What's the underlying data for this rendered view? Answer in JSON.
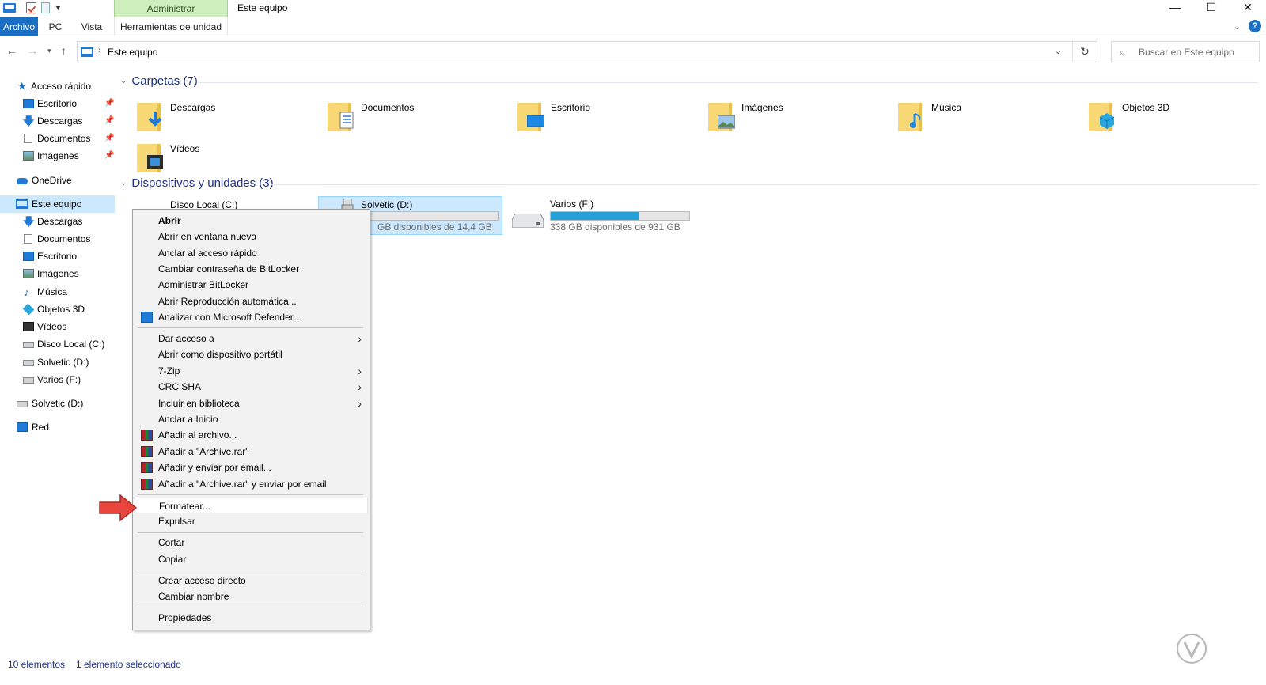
{
  "window": {
    "title": "Este equipo",
    "context_tab_header": "Administrar",
    "controls": [
      "—",
      "☐",
      "✕"
    ]
  },
  "ribbon": {
    "tabs": [
      "Archivo",
      "PC",
      "Vista",
      "Herramientas de unidad"
    ]
  },
  "address": {
    "path": "Este equipo",
    "search_placeholder": "Buscar en Este equipo"
  },
  "nav": {
    "items": [
      {
        "label": "Acceso rápido",
        "icon": "star-icon"
      },
      {
        "label": "Escritorio",
        "icon": "desktop-icon",
        "pinned": true
      },
      {
        "label": "Descargas",
        "icon": "download-icon",
        "pinned": true
      },
      {
        "label": "Documentos",
        "icon": "document-icon",
        "pinned": true
      },
      {
        "label": "Imágenes",
        "icon": "image-icon",
        "pinned": true
      },
      {
        "label": "OneDrive",
        "icon": "cloud-icon"
      },
      {
        "label": "Este equipo",
        "icon": "pc-icon",
        "selected": true
      },
      {
        "label": "Descargas",
        "icon": "download-icon"
      },
      {
        "label": "Documentos",
        "icon": "document-icon"
      },
      {
        "label": "Escritorio",
        "icon": "desktop-icon"
      },
      {
        "label": "Imágenes",
        "icon": "image-icon"
      },
      {
        "label": "Música",
        "icon": "music-icon"
      },
      {
        "label": "Objetos 3D",
        "icon": "cube-icon"
      },
      {
        "label": "Vídeos",
        "icon": "video-icon"
      },
      {
        "label": "Disco Local (C:)",
        "icon": "drive-icon"
      },
      {
        "label": "Solvetic (D:)",
        "icon": "usb-drive-icon"
      },
      {
        "label": "Varios (F:)",
        "icon": "drive-icon"
      },
      {
        "label": "Solvetic (D:)",
        "icon": "usb-drive-icon"
      },
      {
        "label": "Red",
        "icon": "network-icon"
      }
    ]
  },
  "content": {
    "folders_header": "Carpetas (7)",
    "folders": [
      {
        "label": "Descargas",
        "icon": "download-folder-icon"
      },
      {
        "label": "Documentos",
        "icon": "documents-folder-icon"
      },
      {
        "label": "Escritorio",
        "icon": "desktop-folder-icon"
      },
      {
        "label": "Imágenes",
        "icon": "pictures-folder-icon"
      },
      {
        "label": "Música",
        "icon": "music-folder-icon"
      },
      {
        "label": "Objetos 3D",
        "icon": "3d-objects-folder-icon"
      },
      {
        "label": "Vídeos",
        "icon": "videos-folder-icon"
      }
    ],
    "devices_header": "Dispositivos y unidades (3)",
    "drives": [
      {
        "label": "Disco Local (C:)",
        "free": ""
      },
      {
        "label": "Solvetic (D:)",
        "free": "GB disponibles de 14,4 GB",
        "used_fraction": 0.0
      },
      {
        "label": "Varios (F:)",
        "free": "338 GB disponibles de 931 GB",
        "used_fraction": 0.64
      }
    ]
  },
  "context_menu": {
    "items": [
      {
        "label": "Abrir",
        "bold": true
      },
      {
        "label": "Abrir en ventana nueva"
      },
      {
        "label": "Anclar al acceso rápido"
      },
      {
        "label": "Cambiar contraseña de BitLocker"
      },
      {
        "label": "Administrar BitLocker"
      },
      {
        "label": "Abrir Reproducción automática..."
      },
      {
        "label": "Analizar con Microsoft Defender...",
        "icon": "defender-icon"
      },
      {
        "label": "Dar acceso a",
        "submenu": true
      },
      {
        "label": "Abrir como dispositivo portátil"
      },
      {
        "label": "7-Zip",
        "submenu": true
      },
      {
        "label": "CRC SHA",
        "submenu": true
      },
      {
        "label": "Incluir en biblioteca",
        "submenu": true
      },
      {
        "label": "Anclar a Inicio"
      },
      {
        "label": "Añadir al archivo...",
        "icon": "winrar-icon"
      },
      {
        "label": "Añadir a \"Archive.rar\"",
        "icon": "winrar-icon"
      },
      {
        "label": "Añadir y enviar por email...",
        "icon": "winrar-icon"
      },
      {
        "label": "Añadir a \"Archive.rar\" y enviar por email",
        "icon": "winrar-icon"
      },
      {
        "label": "Formatear...",
        "highlighted": true
      },
      {
        "label": "Expulsar"
      },
      {
        "label": "Cortar"
      },
      {
        "label": "Copiar"
      },
      {
        "label": "Crear acceso directo"
      },
      {
        "label": "Cambiar nombre"
      },
      {
        "label": "Propiedades"
      }
    ]
  },
  "status": {
    "count": "10 elementos",
    "selected": "1 elemento seleccionado"
  },
  "colors": {
    "accent": "#1a6fc4",
    "context_tab": "#cfefbf",
    "selection": "#cce8ff",
    "drive_bar": "#26a0da",
    "arrow": "#e8453c"
  }
}
